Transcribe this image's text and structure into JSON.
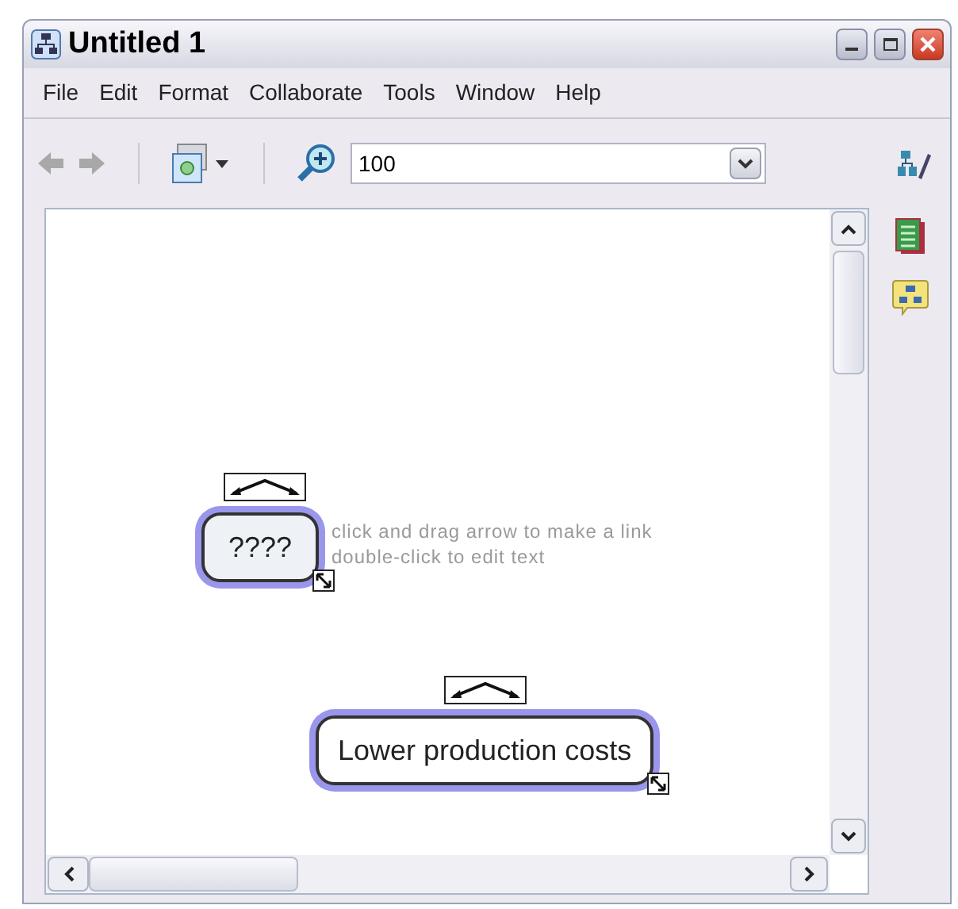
{
  "window": {
    "title": "Untitled 1"
  },
  "menu": [
    "File",
    "Edit",
    "Format",
    "Collaborate",
    "Tools",
    "Window",
    "Help"
  ],
  "toolbar": {
    "zoom": "100"
  },
  "concepts": [
    {
      "text": "????",
      "selected": true,
      "hint": [
        "click and drag arrow to make a link",
        "double-click to edit text"
      ]
    },
    {
      "text": "Lower production costs",
      "selected": true
    }
  ]
}
